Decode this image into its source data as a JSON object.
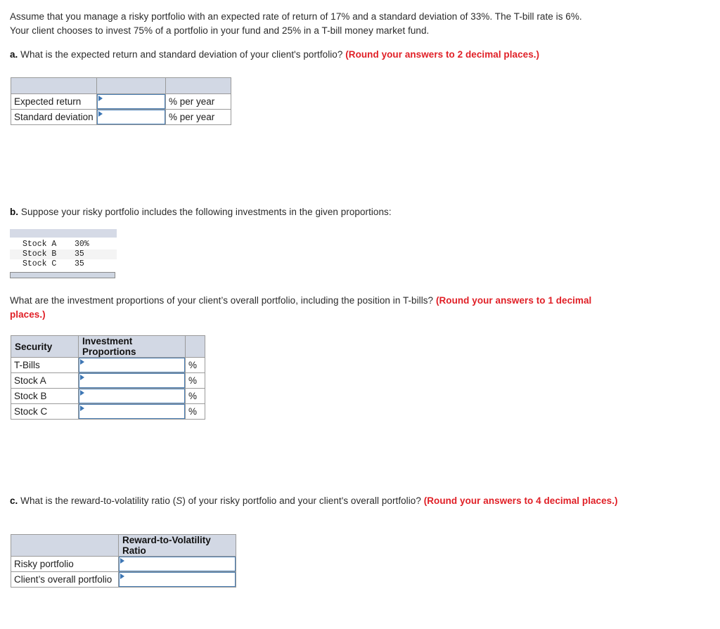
{
  "intro": {
    "line1": "Assume that you manage a risky portfolio with an expected rate of return of 17% and a standard deviation of 33%. The T-bill rate is 6%.",
    "line2": "Your client chooses to invest 75% of a portfolio in your fund and 25% in a T-bill money market fund."
  },
  "question_a": {
    "label": "a.",
    "text": "What is the expected return and standard deviation of your client's portfolio?",
    "instruction": "(Round your answers to 2 decimal places.)"
  },
  "table_a": {
    "header_cells": [
      "",
      "",
      ""
    ],
    "rows": [
      {
        "label": "Expected return",
        "value": "",
        "unit": "% per year"
      },
      {
        "label": "Standard deviation",
        "value": "",
        "unit": "% per year"
      }
    ]
  },
  "question_b": {
    "label": "b.",
    "text": "Suppose your risky portfolio includes the following investments in the given proportions:"
  },
  "proportions_block": {
    "rows": [
      {
        "name": "Stock A",
        "value": "30%"
      },
      {
        "name": "Stock B",
        "value": "35"
      },
      {
        "name": "Stock C",
        "value": "35"
      }
    ]
  },
  "question_b2": {
    "text": "What are the investment proportions of your client’s overall portfolio, including the position in T-bills?",
    "instruction": "(Round your answers to 1 decimal places.)"
  },
  "table_b": {
    "headers": [
      "Security",
      "Investment Proportions",
      ""
    ],
    "rows": [
      {
        "label": "T-Bills",
        "value": "",
        "unit": "%"
      },
      {
        "label": "Stock A",
        "value": "",
        "unit": "%"
      },
      {
        "label": "Stock B",
        "value": "",
        "unit": "%"
      },
      {
        "label": "Stock C",
        "value": "",
        "unit": "%"
      }
    ]
  },
  "question_c": {
    "label": "c.",
    "text_before": "What is the reward-to-volatility ratio (",
    "symbol": "S",
    "text_after": ") of your risky portfolio and your client's overall portfolio?",
    "instruction": "(Round your answers to 4 decimal places.)"
  },
  "table_c": {
    "headers": [
      "",
      "Reward-to-Volatility Ratio"
    ],
    "rows": [
      {
        "label": "Risky portfolio",
        "value": ""
      },
      {
        "label": "Client’s overall portfolio",
        "value": ""
      }
    ]
  },
  "colors": {
    "instruction_red": "#e01f26",
    "header_fill": "#d2d8e4",
    "input_border": "#4a7fb5",
    "cell_border": "#9a9a9a"
  }
}
